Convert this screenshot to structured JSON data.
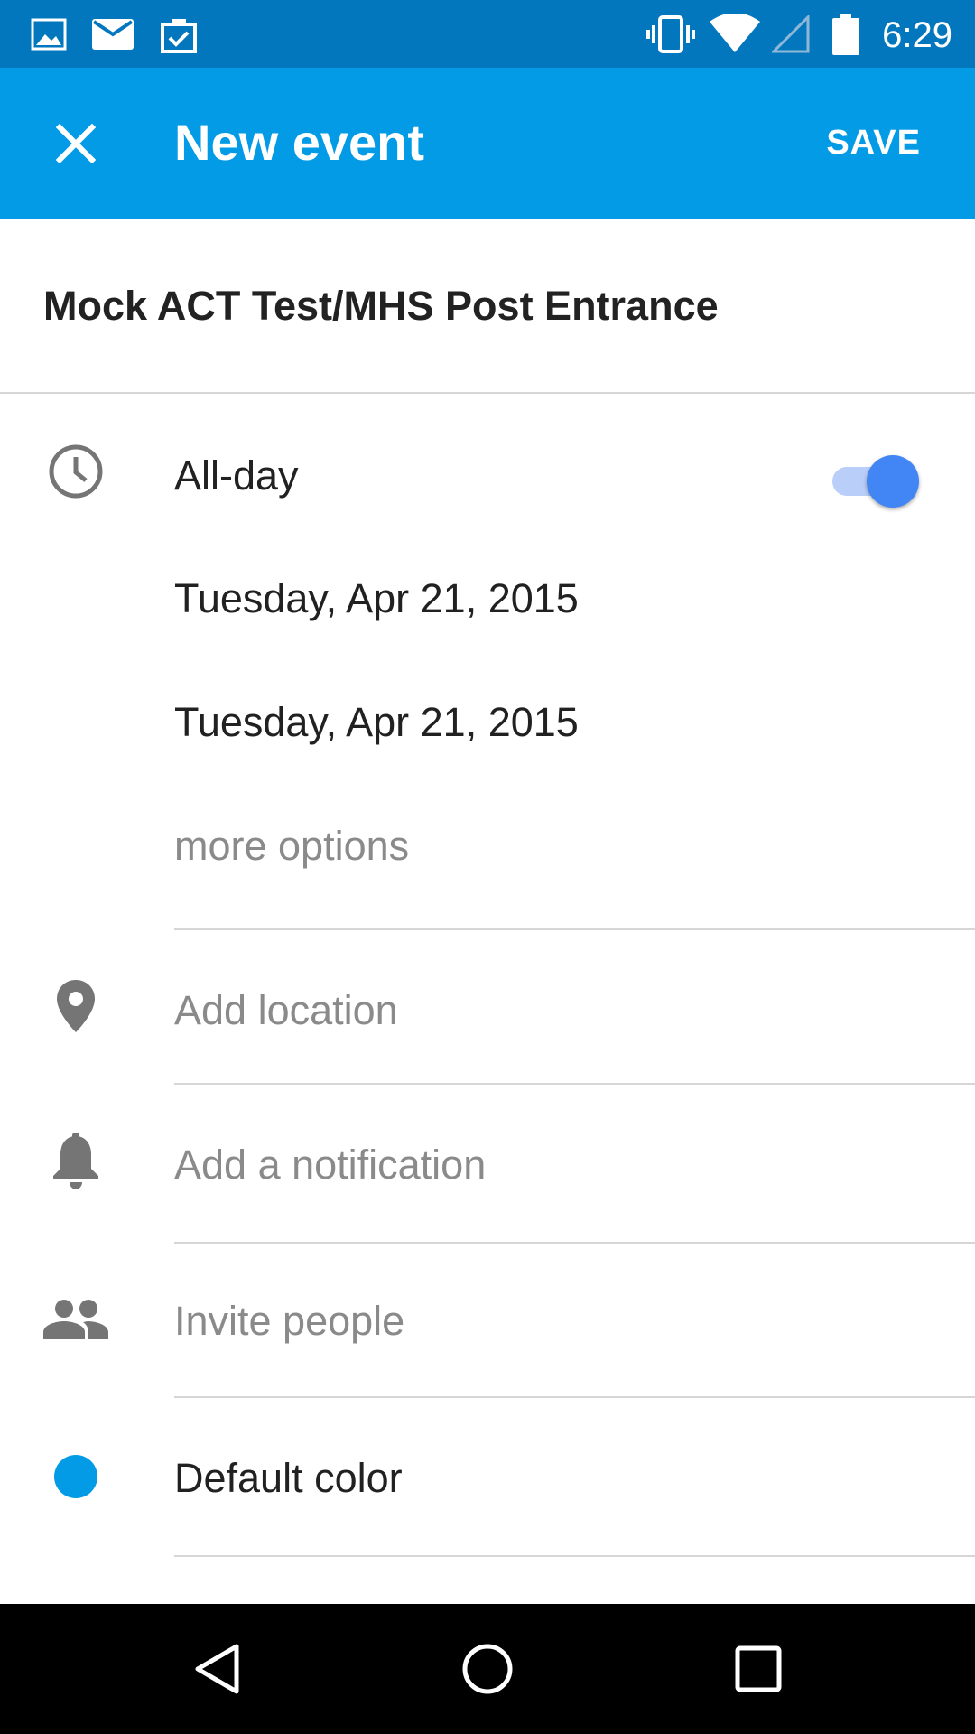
{
  "status_bar": {
    "time": "6:29",
    "icons": [
      "image-icon",
      "mail-icon",
      "clipboard-check-icon",
      "vibrate-icon",
      "wifi-icon",
      "cell-signal-icon",
      "battery-icon"
    ]
  },
  "app_bar": {
    "title": "New event",
    "save_label": "SAVE",
    "close_icon": "close-icon"
  },
  "event": {
    "title": "Mock ACT Test/MHS Post Entrance"
  },
  "time_section": {
    "all_day_label": "All-day",
    "all_day_on": true,
    "start_date": "Tuesday, Apr 21, 2015",
    "end_date": "Tuesday, Apr 21, 2015",
    "more_options": "more options"
  },
  "fields": {
    "location_placeholder": "Add location",
    "notification_placeholder": "Add a notification",
    "invite_placeholder": "Invite people",
    "color_label": "Default color"
  },
  "colors": {
    "status_bar": "#0277bd",
    "app_bar": "#039be5",
    "toggle_thumb": "#4285f4",
    "toggle_track": "#b9cef8",
    "event_color": "#039be5"
  },
  "nav_bar": {
    "icons": [
      "back-icon",
      "home-icon",
      "recents-icon"
    ]
  }
}
